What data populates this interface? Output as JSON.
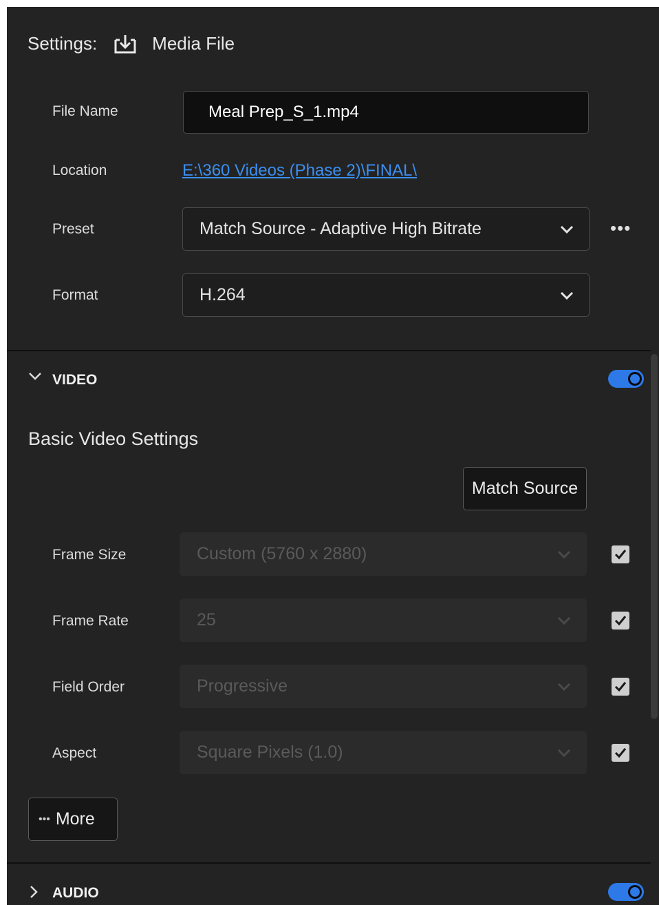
{
  "header": {
    "settings_label": "Settings:",
    "destination_label": "Media File",
    "destination_icon": "export-download-icon"
  },
  "fields": {
    "file_name": {
      "label": "File Name",
      "value": "Meal Prep_S_1.mp4"
    },
    "location": {
      "label": "Location",
      "value": "E:\\360 Videos (Phase 2)\\FINAL\\"
    },
    "preset": {
      "label": "Preset",
      "value": "Match Source - Adaptive High Bitrate",
      "more": "•••"
    },
    "format": {
      "label": "Format",
      "value": "H.264"
    }
  },
  "video": {
    "section_label": "VIDEO",
    "enabled": true,
    "subheading": "Basic Video Settings",
    "match_source_label": "Match Source",
    "rows": [
      {
        "label": "Frame Size",
        "value": "Custom (5760 x 2880)",
        "checked": true
      },
      {
        "label": "Frame Rate",
        "value": "25",
        "checked": true
      },
      {
        "label": "Field Order",
        "value": "Progressive",
        "checked": true
      },
      {
        "label": "Aspect",
        "value": "Square Pixels (1.0)",
        "checked": true
      }
    ],
    "more_label": "More",
    "more_dots": "•••"
  },
  "audio": {
    "section_label": "AUDIO",
    "enabled": true
  },
  "colors": {
    "panel": "#232323",
    "accent": "#2d79e8",
    "link": "#3b8ff0"
  }
}
